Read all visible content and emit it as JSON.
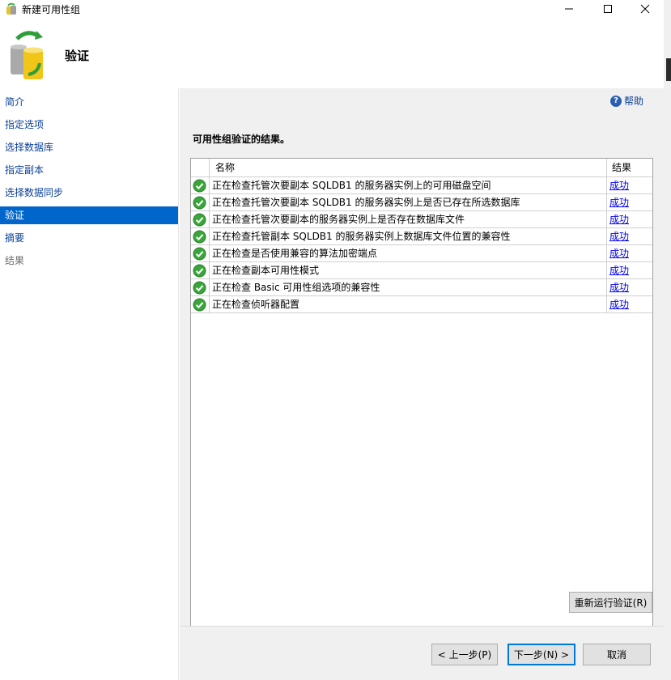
{
  "window": {
    "title": "新建可用性组",
    "minimize_icon": "minimize-icon",
    "maximize_icon": "maximize-icon",
    "close_icon": "close-icon"
  },
  "header": {
    "title": "验证",
    "icon": "database-sync-icon"
  },
  "sidebar": {
    "items": [
      {
        "label": "简介",
        "state": "link"
      },
      {
        "label": "指定选项",
        "state": "link"
      },
      {
        "label": "选择数据库",
        "state": "link"
      },
      {
        "label": "指定副本",
        "state": "link"
      },
      {
        "label": "选择数据同步",
        "state": "link"
      },
      {
        "label": "验证",
        "state": "active"
      },
      {
        "label": "摘要",
        "state": "link"
      },
      {
        "label": "结果",
        "state": "disabled"
      }
    ]
  },
  "main": {
    "help_label": "帮助",
    "section_title": "可用性组验证的结果。",
    "grid": {
      "columns": [
        "名称",
        "结果"
      ],
      "rows": [
        {
          "name": "正在检查托管次要副本 SQLDB1 的服务器实例上的可用磁盘空间",
          "result": "成功",
          "status_icon": "success-check-icon"
        },
        {
          "name": "正在检查托管次要副本 SQLDB1 的服务器实例上是否已存在所选数据库",
          "result": "成功",
          "status_icon": "success-check-icon"
        },
        {
          "name": "正在检查托管次要副本的服务器实例上是否存在数据库文件",
          "result": "成功",
          "status_icon": "success-check-icon"
        },
        {
          "name": "正在检查托管副本 SQLDB1 的服务器实例上数据库文件位置的兼容性",
          "result": "成功",
          "status_icon": "success-check-icon"
        },
        {
          "name": "正在检查是否使用兼容的算法加密端点",
          "result": "成功",
          "status_icon": "success-check-icon"
        },
        {
          "name": "正在检查副本可用性模式",
          "result": "成功",
          "status_icon": "success-check-icon"
        },
        {
          "name": "正在检查 Basic 可用性组选项的兼容性",
          "result": "成功",
          "status_icon": "success-check-icon"
        },
        {
          "name": "正在检查侦听器配置",
          "result": "成功",
          "status_icon": "success-check-icon"
        }
      ]
    },
    "rerun_label": "重新运行验证(R)"
  },
  "footer": {
    "back_label": "< 上一步(P)",
    "next_label": "下一步(N) >",
    "cancel_label": "取消"
  },
  "colors": {
    "active_nav": "#0066cc",
    "link": "#0a3f96",
    "success": "#3aa63a"
  }
}
